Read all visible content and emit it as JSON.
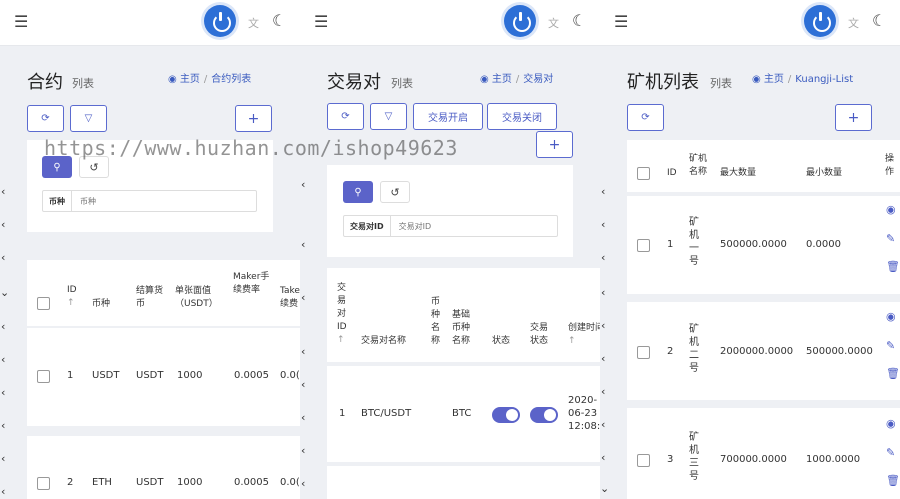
{
  "watermark": "https://www.huzhan.com/ishop49623",
  "panels": [
    {
      "title": "合约",
      "subtitle": "列表",
      "crumb_home": "主页",
      "crumb_current": "合约列表",
      "filter": {
        "label": "币种",
        "placeholder": "币种"
      },
      "add_label": "+",
      "columns": [
        "ID",
        "币种",
        "结算货币",
        "单张面值（USDT）",
        "Maker手续费率",
        "Take续费"
      ],
      "rows": [
        {
          "id": "1",
          "coin": "USDT",
          "settle": "USDT",
          "face": "1000",
          "maker": "0.0005",
          "taker": "0.0("
        },
        {
          "id": "2",
          "coin": "ETH",
          "settle": "USDT",
          "face": "1000",
          "maker": "0.0005",
          "taker": "0.0("
        }
      ]
    },
    {
      "title": "交易对",
      "subtitle": "列表",
      "crumb_home": "主页",
      "crumb_current": "交易对",
      "open_label": "交易开启",
      "close_label": "交易关闭",
      "add_label": "+",
      "filter": {
        "label": "交易对ID",
        "placeholder": "交易对ID"
      },
      "columns": [
        "交易对ID",
        "交易对名称",
        "币种名称",
        "基础币种名称",
        "状态",
        "交易状态",
        "创建时间"
      ],
      "rows": [
        {
          "id": "1",
          "name": "BTC/USDT",
          "base": "BTC",
          "status_on": true,
          "trade_on": true,
          "created": "2020-06-23 12:08:"
        }
      ]
    },
    {
      "title": "矿机列表",
      "subtitle": "列表",
      "crumb_home": "主页",
      "crumb_current": "Kuangji-List",
      "add_label": "+",
      "columns": [
        "ID",
        "矿机名称",
        "最大数量",
        "最小数量",
        "操作"
      ],
      "rows": [
        {
          "id": "1",
          "name": "矿机一号",
          "max": "500000.0000",
          "min": "0.0000"
        },
        {
          "id": "2",
          "name": "矿机二号",
          "max": "2000000.0000",
          "min": "500000.0000"
        },
        {
          "id": "3",
          "name": "矿机三号",
          "max": "700000.0000",
          "min": "1000.0000"
        }
      ]
    }
  ]
}
